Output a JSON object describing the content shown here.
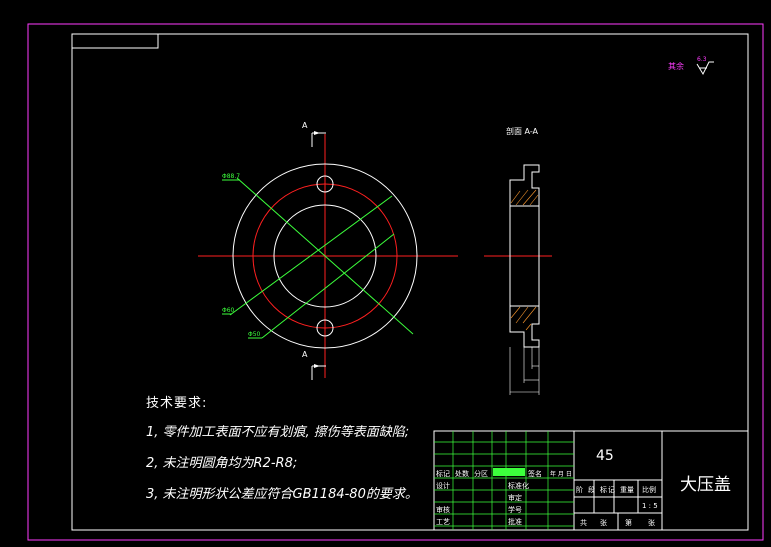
{
  "surface_finish": {
    "label": "其余",
    "value": "6.3"
  },
  "section_label": "A",
  "section_title": "剖面 A-A",
  "dims": {
    "d1": "Φ88.7",
    "d2": "Φ60",
    "d3": "Φ50"
  },
  "notes": {
    "heading": "技术要求:",
    "lines": [
      "1, 零件加工表面不应有划痕, 擦伤等表面缺陷;",
      "2, 未注明圆角均为R2-R8;",
      "3, 未注明形状公差应符合GB1184-80的要求。"
    ]
  },
  "title_block": {
    "material": "45",
    "part_name": "大压盖",
    "row1": [
      "标记",
      "处数",
      "分区",
      "",
      "签名",
      "年 月 日"
    ],
    "design": "设计",
    "standard": "标准化",
    "check": "审核",
    "process": "工艺",
    "approve": "批准",
    "review": "审定",
    "student": "学号",
    "stage": [
      "阶",
      "段",
      "标",
      "记"
    ],
    "weight": "重量",
    "scale_label": "比例",
    "scale": "1 : 5",
    "sheet": [
      "共",
      "张",
      "第",
      "张"
    ]
  }
}
